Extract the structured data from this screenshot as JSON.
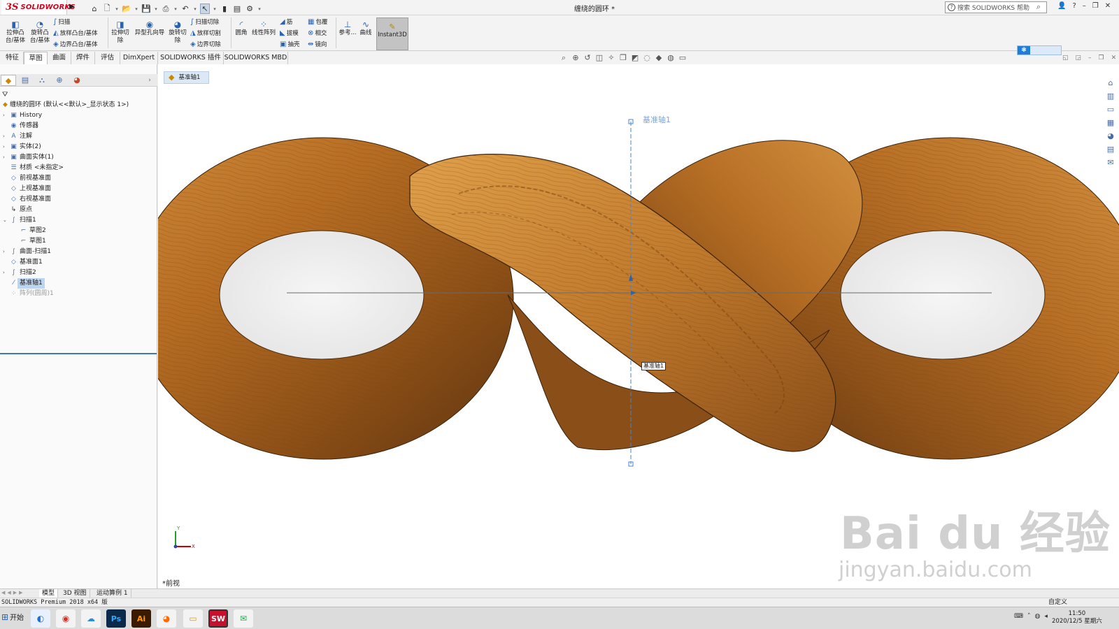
{
  "titlebar": {
    "logo_ds": "3S",
    "logo_sw": "SOLIDWORKS",
    "doc_title": "缠绕的圆环 *",
    "search_placeholder": "搜索 SOLIDWORKS 帮助",
    "help": "?"
  },
  "ribbon": {
    "extrude_boss": [
      "拉伸凸",
      "台/基体"
    ],
    "revolve_boss": [
      "旋转凸",
      "台/基体"
    ],
    "sweep": "扫描",
    "loft_boss": "放样凸台/基体",
    "boundary_boss": "边界凸台/基体",
    "extrude_cut": [
      "拉伸切",
      "除"
    ],
    "hole_wizard": "异型孔向导",
    "revolve_cut": [
      "旋转切",
      "除"
    ],
    "sweep_cut": "扫描切除",
    "loft_cut": "放样切割",
    "boundary_cut": "边界切除",
    "fillet": "圆角",
    "linear_pattern": "线性阵列",
    "rib": "筋",
    "draft": "拔模",
    "shell": "抽壳",
    "wrap": "包覆",
    "intersect": "相交",
    "mirror": "镜向",
    "reference": "参考...",
    "curves": "曲线",
    "instant3d": "Instant3D"
  },
  "tabs": [
    "特征",
    "草图",
    "曲面",
    "焊件",
    "评估",
    "DimXpert",
    "SOLIDWORKS 插件",
    "SOLIDWORKS MBD"
  ],
  "tree": {
    "root": "缠绕的圆环 (默认<<默认>_显示状态 1>)",
    "items": [
      {
        "label": "History"
      },
      {
        "label": "传感器"
      },
      {
        "label": "注解"
      },
      {
        "label": "实体(2)"
      },
      {
        "label": "曲面实体(1)"
      },
      {
        "label": "材质 <未指定>"
      },
      {
        "label": "前视基准面"
      },
      {
        "label": "上视基准面"
      },
      {
        "label": "右视基准面"
      },
      {
        "label": "原点"
      },
      {
        "label": "扫描1"
      },
      {
        "label": "草图2"
      },
      {
        "label": "草图1"
      },
      {
        "label": "曲面-扫描1"
      },
      {
        "label": "基准面1"
      },
      {
        "label": "扫描2"
      },
      {
        "label": "基准轴1"
      },
      {
        "label": "阵列(圆周)1"
      }
    ]
  },
  "viewport": {
    "crumb": "基准轴1",
    "axis_label": "基准轴1",
    "axis_tag": "基准轴1",
    "view_name": "*前视",
    "triad_x": "X",
    "triad_y": "Y",
    "watermark_main": "Bai  du 经验",
    "watermark_url": "jingyan.baidu.com"
  },
  "bottom_tabs": [
    "模型",
    "3D 视图",
    "运动算例 1"
  ],
  "status": {
    "version": "SOLIDWORKS Premium 2018 x64 版",
    "custom": "自定义"
  },
  "taskbar": {
    "start": "开始",
    "apps": [
      "browser-qq",
      "chrome",
      "baidu-netdisk",
      "Ps",
      "Ai",
      "firefox",
      "explorer",
      "SW",
      "wechat"
    ],
    "time": "11:50",
    "date": "2020/12/5 星期六"
  },
  "colors": {
    "accent": "#2a64b0",
    "selection": "#bcd6f2",
    "wood": "#b8742a"
  }
}
